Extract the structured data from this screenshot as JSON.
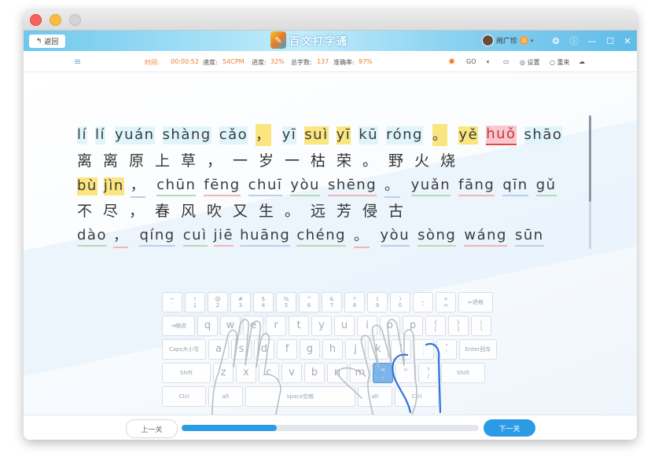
{
  "header": {
    "back_label": "返回",
    "app_title": "百文打字通",
    "user_name": "闹广珍",
    "user_badge": "①"
  },
  "status": {
    "time_label": "时间:",
    "time_value": "00:00:52",
    "speed_label": "速度:",
    "speed_value": "54CPM",
    "progress_label": "进度:",
    "progress_value": "32%",
    "total_label": "总字数:",
    "total_value": "137",
    "accuracy_label": "准确率:",
    "accuracy_value": "97%",
    "go_label": "GO",
    "settings_label": "设置",
    "restart_label": "重来"
  },
  "text": {
    "pinyin": [
      [
        "lí",
        "lí",
        "yuán",
        "shàng",
        "cǎo",
        "，",
        "yī",
        "suì",
        "yī",
        "kū",
        "róng",
        "。",
        "yě",
        "huǒ",
        "shāo"
      ],
      [
        "bù",
        "jìn",
        "，",
        "chūn",
        "fēng",
        "chuī",
        "yòu",
        "shēng",
        "。",
        "yuǎn",
        "fāng",
        "qīn",
        "gǔ"
      ],
      [
        "dào",
        "，",
        "qíng",
        "cuì",
        "jiē",
        "huāng",
        "chéng",
        "。",
        "yòu",
        "sòng",
        "wáng",
        "sūn"
      ]
    ],
    "hanzi": [
      "离离原上草，一岁一枯荣。野火烧",
      "不尽，春风吹又生。远芳侵古"
    ]
  },
  "keyboard": {
    "row1": [
      [
        "~",
        "`"
      ],
      [
        "!",
        "1"
      ],
      [
        "@",
        "2"
      ],
      [
        "#",
        "3"
      ],
      [
        "$",
        "4"
      ],
      [
        "%",
        "5"
      ],
      [
        "^",
        "6"
      ],
      [
        "&",
        "7"
      ],
      [
        "*",
        "8"
      ],
      [
        "(",
        "9"
      ],
      [
        ")",
        "0"
      ],
      [
        "_",
        "-"
      ],
      [
        "+",
        "="
      ],
      [
        "⇐退格",
        ""
      ]
    ],
    "row2": [
      "⇥缩进",
      "q",
      "w",
      "e",
      "r",
      "t",
      "y",
      "u",
      "i",
      "o",
      "p",
      [
        "{",
        "["
      ],
      [
        "}",
        "]"
      ],
      [
        "|",
        "\\"
      ]
    ],
    "row3": [
      "Caps大小写",
      "a",
      "s",
      "d",
      "f",
      "g",
      "h",
      "j",
      "k",
      "l",
      [
        ":",
        ";"
      ],
      [
        "\"",
        "'"
      ],
      "Enter回车"
    ],
    "row4": [
      "Shift",
      "z",
      "x",
      "c",
      "v",
      "b",
      "n",
      "m",
      [
        "<",
        ","
      ],
      [
        ">",
        "."
      ],
      [
        "?",
        "/"
      ],
      "Shift"
    ],
    "row5": [
      "Ctrl",
      "alt",
      "space空格",
      "alt",
      "Ctrl"
    ]
  },
  "progress": 0.32,
  "footer": {
    "prev_label": "上一关",
    "next_label": "下一关"
  }
}
